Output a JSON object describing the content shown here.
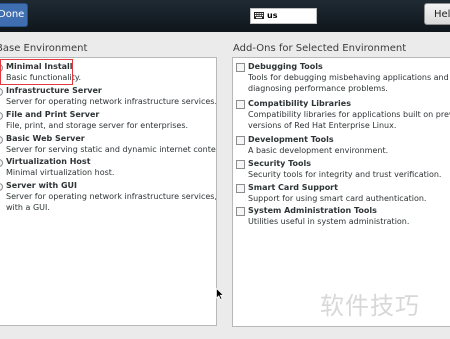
{
  "toolbar": {
    "done_label": "Done",
    "keyboard_layout": "us",
    "help_label": "Help!"
  },
  "base_environment": {
    "heading": "Base Environment",
    "items": [
      {
        "title": "Minimal Install",
        "description": [
          "Basic functionality."
        ],
        "selected": true
      },
      {
        "title": "Infrastructure Server",
        "description": [
          "Server for operating network infrastructure services."
        ]
      },
      {
        "title": "File and Print Server",
        "description": [
          "File, print, and storage server for enterprises."
        ]
      },
      {
        "title": "Basic Web Server",
        "description": [
          "Server for serving static and dynamic internet content."
        ]
      },
      {
        "title": "Virtualization Host",
        "description": [
          "Minimal virtualization host."
        ]
      },
      {
        "title": "Server with GUI",
        "description": [
          "Server for operating network infrastructure services,",
          "with a GUI."
        ]
      }
    ]
  },
  "addons": {
    "heading": "Add-Ons for Selected Environment",
    "items": [
      {
        "title": "Debugging Tools",
        "description": [
          "Tools for debugging misbehaving applications and",
          "diagnosing performance problems."
        ]
      },
      {
        "title": "Compatibility Libraries",
        "description": [
          "Compatibility libraries for applications built on previous",
          "versions of Red Hat Enterprise Linux."
        ]
      },
      {
        "title": "Development Tools",
        "description": [
          "A basic development environment."
        ]
      },
      {
        "title": "Security Tools",
        "description": [
          "Security tools for integrity and trust verification."
        ]
      },
      {
        "title": "Smart Card Support",
        "description": [
          "Support for using smart card authentication."
        ]
      },
      {
        "title": "System Administration Tools",
        "description": [
          "Utilities useful in system administration."
        ]
      }
    ]
  },
  "watermark": "软件技巧"
}
